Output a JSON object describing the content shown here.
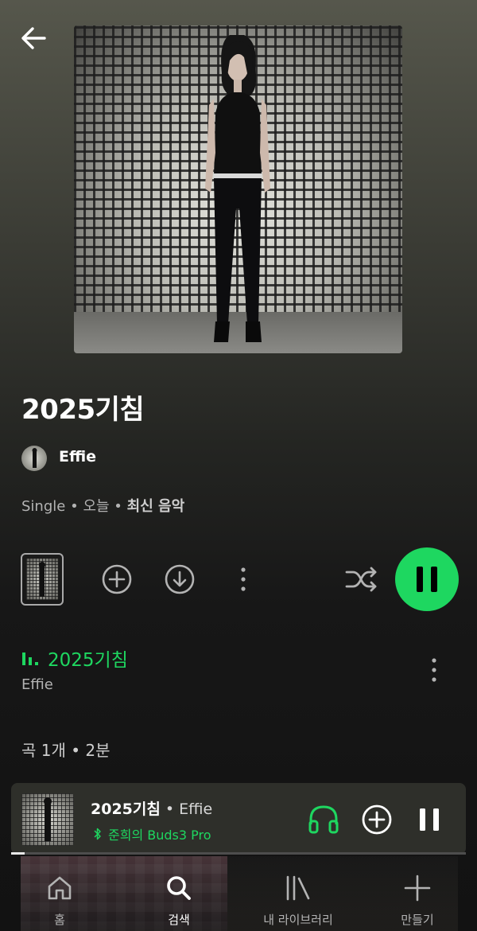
{
  "header": {
    "back_icon": "arrow-left-icon"
  },
  "album": {
    "title": "2025기침",
    "artist": "Effie",
    "meta": {
      "type": "Single",
      "date": "오늘",
      "tag": "최신 음악",
      "separator": "•"
    }
  },
  "actions": {
    "add_icon": "plus-circle-icon",
    "download_icon": "download-icon",
    "more_icon": "more-vertical-icon",
    "shuffle_icon": "shuffle-icon",
    "play_state": "pause"
  },
  "tracks": [
    {
      "title": "2025기침",
      "artist": "Effie",
      "playing": true
    }
  ],
  "summary": "곡 1개 • 2분",
  "mini_player": {
    "title": "2025기침",
    "separator": "•",
    "artist": "Effie",
    "device": "준희의 Buds3 Pro",
    "progress": 0.03
  },
  "nav": [
    {
      "label": "홈",
      "icon": "home-icon",
      "active": false
    },
    {
      "label": "검색",
      "icon": "search-icon",
      "active": true
    },
    {
      "label": "내 라이브러리",
      "icon": "library-icon",
      "active": false
    },
    {
      "label": "만들기",
      "icon": "plus-icon",
      "active": false
    }
  ],
  "colors": {
    "accent": "#1ed760",
    "background": "#121212",
    "text_secondary": "#b3b3b3"
  }
}
